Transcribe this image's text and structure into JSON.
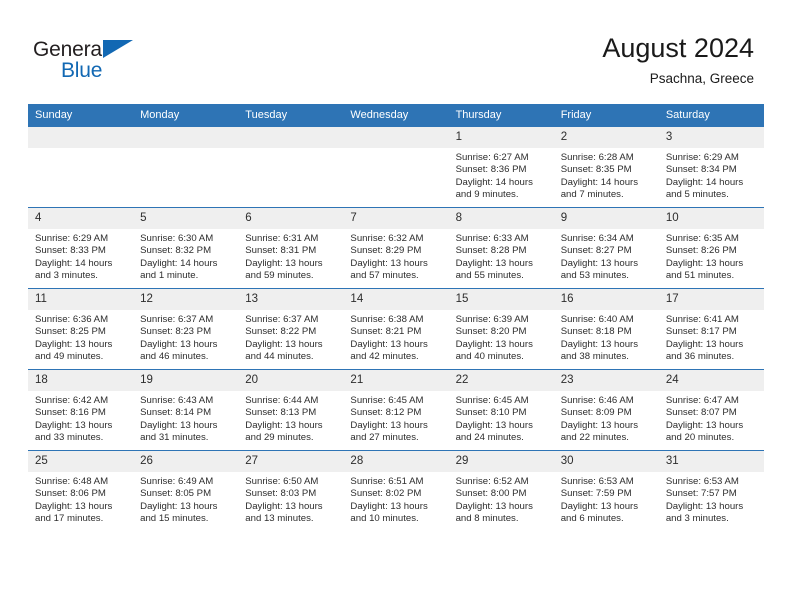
{
  "brand": {
    "word_one": "General",
    "word_two": "Blue",
    "triangle_icon": "blue-triangle-icon",
    "color_dark": "#231f20",
    "color_blue": "#1268b3"
  },
  "header": {
    "title": "August 2024",
    "subtitle": "Psachna, Greece"
  },
  "theme": {
    "header_blue": "#2e74b5",
    "daynum_gray": "#efefef",
    "text": "#2d2d2d"
  },
  "calendar": {
    "weekday_headers": [
      "Sunday",
      "Monday",
      "Tuesday",
      "Wednesday",
      "Thursday",
      "Friday",
      "Saturday"
    ],
    "weeks": [
      [
        {
          "day": "",
          "blank": true,
          "text": ""
        },
        {
          "day": "",
          "blank": true,
          "text": ""
        },
        {
          "day": "",
          "blank": true,
          "text": ""
        },
        {
          "day": "",
          "blank": true,
          "text": ""
        },
        {
          "day": "1",
          "blank": false,
          "text": "Sunrise: 6:27 AM\nSunset: 8:36 PM\nDaylight: 14 hours\nand 9 minutes."
        },
        {
          "day": "2",
          "blank": false,
          "text": "Sunrise: 6:28 AM\nSunset: 8:35 PM\nDaylight: 14 hours\nand 7 minutes."
        },
        {
          "day": "3",
          "blank": false,
          "text": "Sunrise: 6:29 AM\nSunset: 8:34 PM\nDaylight: 14 hours\nand 5 minutes."
        }
      ],
      [
        {
          "day": "4",
          "blank": false,
          "text": "Sunrise: 6:29 AM\nSunset: 8:33 PM\nDaylight: 14 hours\nand 3 minutes."
        },
        {
          "day": "5",
          "blank": false,
          "text": "Sunrise: 6:30 AM\nSunset: 8:32 PM\nDaylight: 14 hours\nand 1 minute."
        },
        {
          "day": "6",
          "blank": false,
          "text": "Sunrise: 6:31 AM\nSunset: 8:31 PM\nDaylight: 13 hours\nand 59 minutes."
        },
        {
          "day": "7",
          "blank": false,
          "text": "Sunrise: 6:32 AM\nSunset: 8:29 PM\nDaylight: 13 hours\nand 57 minutes."
        },
        {
          "day": "8",
          "blank": false,
          "text": "Sunrise: 6:33 AM\nSunset: 8:28 PM\nDaylight: 13 hours\nand 55 minutes."
        },
        {
          "day": "9",
          "blank": false,
          "text": "Sunrise: 6:34 AM\nSunset: 8:27 PM\nDaylight: 13 hours\nand 53 minutes."
        },
        {
          "day": "10",
          "blank": false,
          "text": "Sunrise: 6:35 AM\nSunset: 8:26 PM\nDaylight: 13 hours\nand 51 minutes."
        }
      ],
      [
        {
          "day": "11",
          "blank": false,
          "text": "Sunrise: 6:36 AM\nSunset: 8:25 PM\nDaylight: 13 hours\nand 49 minutes."
        },
        {
          "day": "12",
          "blank": false,
          "text": "Sunrise: 6:37 AM\nSunset: 8:23 PM\nDaylight: 13 hours\nand 46 minutes."
        },
        {
          "day": "13",
          "blank": false,
          "text": "Sunrise: 6:37 AM\nSunset: 8:22 PM\nDaylight: 13 hours\nand 44 minutes."
        },
        {
          "day": "14",
          "blank": false,
          "text": "Sunrise: 6:38 AM\nSunset: 8:21 PM\nDaylight: 13 hours\nand 42 minutes."
        },
        {
          "day": "15",
          "blank": false,
          "text": "Sunrise: 6:39 AM\nSunset: 8:20 PM\nDaylight: 13 hours\nand 40 minutes."
        },
        {
          "day": "16",
          "blank": false,
          "text": "Sunrise: 6:40 AM\nSunset: 8:18 PM\nDaylight: 13 hours\nand 38 minutes."
        },
        {
          "day": "17",
          "blank": false,
          "text": "Sunrise: 6:41 AM\nSunset: 8:17 PM\nDaylight: 13 hours\nand 36 minutes."
        }
      ],
      [
        {
          "day": "18",
          "blank": false,
          "text": "Sunrise: 6:42 AM\nSunset: 8:16 PM\nDaylight: 13 hours\nand 33 minutes."
        },
        {
          "day": "19",
          "blank": false,
          "text": "Sunrise: 6:43 AM\nSunset: 8:14 PM\nDaylight: 13 hours\nand 31 minutes."
        },
        {
          "day": "20",
          "blank": false,
          "text": "Sunrise: 6:44 AM\nSunset: 8:13 PM\nDaylight: 13 hours\nand 29 minutes."
        },
        {
          "day": "21",
          "blank": false,
          "text": "Sunrise: 6:45 AM\nSunset: 8:12 PM\nDaylight: 13 hours\nand 27 minutes."
        },
        {
          "day": "22",
          "blank": false,
          "text": "Sunrise: 6:45 AM\nSunset: 8:10 PM\nDaylight: 13 hours\nand 24 minutes."
        },
        {
          "day": "23",
          "blank": false,
          "text": "Sunrise: 6:46 AM\nSunset: 8:09 PM\nDaylight: 13 hours\nand 22 minutes."
        },
        {
          "day": "24",
          "blank": false,
          "text": "Sunrise: 6:47 AM\nSunset: 8:07 PM\nDaylight: 13 hours\nand 20 minutes."
        }
      ],
      [
        {
          "day": "25",
          "blank": false,
          "text": "Sunrise: 6:48 AM\nSunset: 8:06 PM\nDaylight: 13 hours\nand 17 minutes."
        },
        {
          "day": "26",
          "blank": false,
          "text": "Sunrise: 6:49 AM\nSunset: 8:05 PM\nDaylight: 13 hours\nand 15 minutes."
        },
        {
          "day": "27",
          "blank": false,
          "text": "Sunrise: 6:50 AM\nSunset: 8:03 PM\nDaylight: 13 hours\nand 13 minutes."
        },
        {
          "day": "28",
          "blank": false,
          "text": "Sunrise: 6:51 AM\nSunset: 8:02 PM\nDaylight: 13 hours\nand 10 minutes."
        },
        {
          "day": "29",
          "blank": false,
          "text": "Sunrise: 6:52 AM\nSunset: 8:00 PM\nDaylight: 13 hours\nand 8 minutes."
        },
        {
          "day": "30",
          "blank": false,
          "text": "Sunrise: 6:53 AM\nSunset: 7:59 PM\nDaylight: 13 hours\nand 6 minutes."
        },
        {
          "day": "31",
          "blank": false,
          "text": "Sunrise: 6:53 AM\nSunset: 7:57 PM\nDaylight: 13 hours\nand 3 minutes."
        }
      ]
    ]
  }
}
